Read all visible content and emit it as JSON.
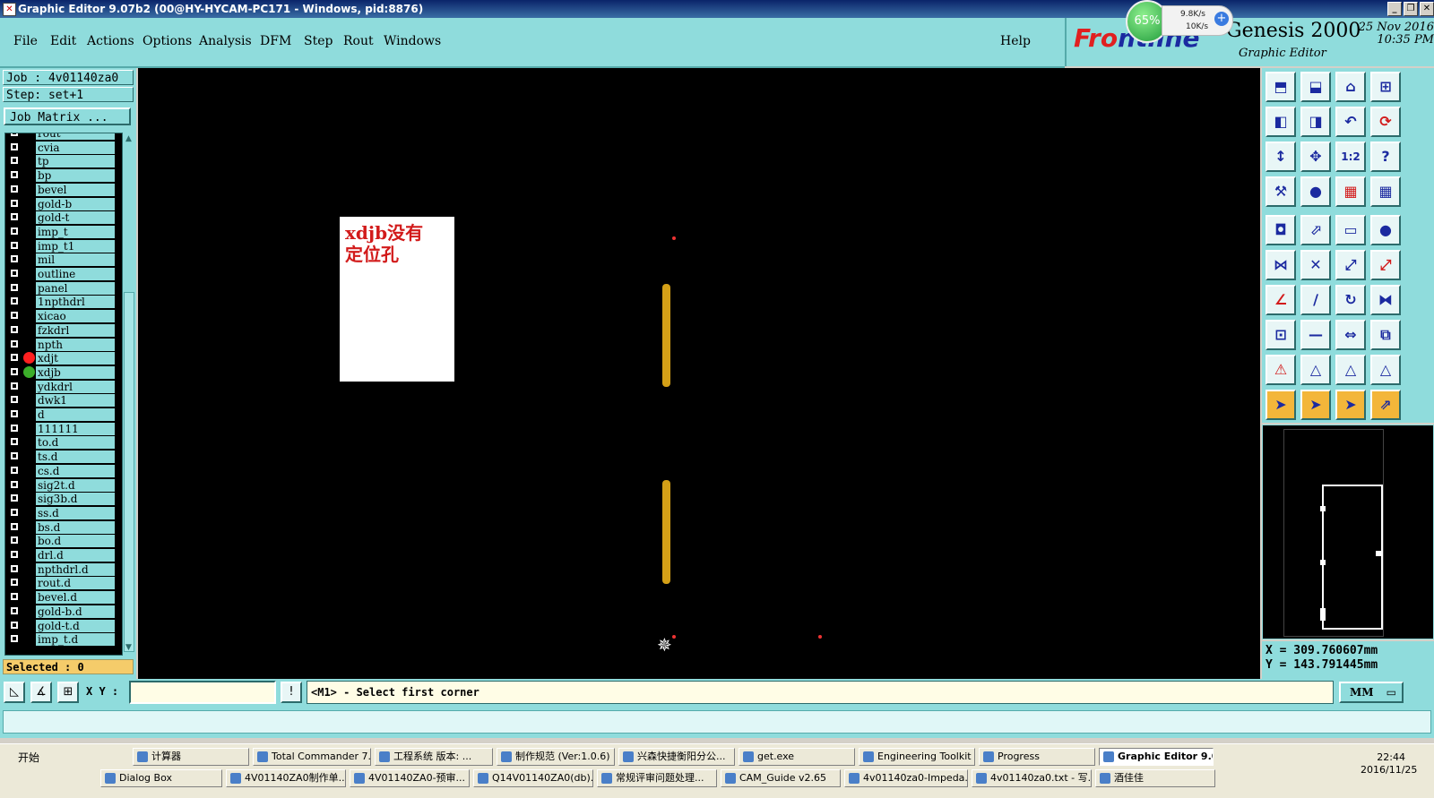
{
  "window": {
    "title": "Graphic Editor 9.07b2 (00@HY-HYCAM-PC171 - Windows, pid:8876)",
    "minimize": "_",
    "restore": "❐",
    "close": "✕"
  },
  "menu": {
    "items": [
      "File",
      "Edit",
      "Actions",
      "Options",
      "Analysis",
      "DFM",
      "Step",
      "Rout",
      "Windows"
    ],
    "help": "Help"
  },
  "brand": {
    "logo_main": "Fro",
    "logo_accent": "ntline",
    "product": "Genesis 2000",
    "subtitle": "Graphic Editor",
    "date": "25 Nov 2016",
    "time": "10:35 PM"
  },
  "network_widget": {
    "percent": "65%",
    "upload": "9.8K/s",
    "download": "10K/s"
  },
  "left_panel": {
    "job": "Job : 4v01140za0",
    "step": "Step: set+1",
    "job_matrix": "Job Matrix ...",
    "layers": [
      {
        "name": "rout",
        "dot": ""
      },
      {
        "name": "cvia",
        "dot": ""
      },
      {
        "name": "tp",
        "dot": ""
      },
      {
        "name": "bp",
        "dot": ""
      },
      {
        "name": "bevel",
        "dot": ""
      },
      {
        "name": "gold-b",
        "dot": ""
      },
      {
        "name": "gold-t",
        "dot": ""
      },
      {
        "name": "imp_t",
        "dot": ""
      },
      {
        "name": "imp_t1",
        "dot": ""
      },
      {
        "name": "mil",
        "dot": ""
      },
      {
        "name": "outline",
        "dot": ""
      },
      {
        "name": "panel",
        "dot": ""
      },
      {
        "name": "1npthdrl",
        "dot": ""
      },
      {
        "name": "xicao",
        "dot": ""
      },
      {
        "name": "fzkdrl",
        "dot": ""
      },
      {
        "name": "npth",
        "dot": ""
      },
      {
        "name": "xdjt",
        "dot": "#ff2020"
      },
      {
        "name": "xdjb",
        "dot": "#3cae2a"
      },
      {
        "name": "ydkdrl",
        "dot": ""
      },
      {
        "name": "dwk1",
        "dot": ""
      },
      {
        "name": "d",
        "dot": ""
      },
      {
        "name": "111111",
        "dot": ""
      },
      {
        "name": "to.d",
        "dot": ""
      },
      {
        "name": "ts.d",
        "dot": ""
      },
      {
        "name": "cs.d",
        "dot": ""
      },
      {
        "name": "sig2t.d",
        "dot": ""
      },
      {
        "name": "sig3b.d",
        "dot": ""
      },
      {
        "name": "ss.d",
        "dot": ""
      },
      {
        "name": "bs.d",
        "dot": ""
      },
      {
        "name": "bo.d",
        "dot": ""
      },
      {
        "name": "drl.d",
        "dot": ""
      },
      {
        "name": "npthdrl.d",
        "dot": ""
      },
      {
        "name": "rout.d",
        "dot": ""
      },
      {
        "name": "bevel.d",
        "dot": ""
      },
      {
        "name": "gold-b.d",
        "dot": ""
      },
      {
        "name": "gold-t.d",
        "dot": ""
      },
      {
        "name": "imp_t.d",
        "dot": ""
      }
    ],
    "selected": "Selected : 0"
  },
  "canvas": {
    "note_text": "xdjb没有\n定位孔",
    "pad_color": "#d4a017"
  },
  "toolbar": {
    "icons": [
      "zoom-home-icon",
      "zoom-out-icon",
      "home-icon",
      "split-view-icon",
      "pan-left-icon",
      "pan-right-icon",
      "undo-view-icon",
      "redraw-icon",
      "fit-height-icon",
      "fit-all-icon",
      "one-to-two-icon",
      "help-icon",
      "tools-icon",
      "snap-icon",
      "layer-red-icon",
      "layer-dual-icon",
      "pad-select-icon",
      "move-icon",
      "measure-icon",
      "round-pad-icon",
      "net-icon",
      "delete-icon",
      "connect-icon",
      "connect-red-icon",
      "line-red-icon",
      "line-icon",
      "rotate-icon",
      "mirror-icon",
      "pad-add-icon",
      "dash-icon",
      "dimension-icon",
      "group-icon",
      "triangle-red-icon",
      "triangle-icon",
      "triangle-blue-icon",
      "triangle-dual-icon",
      "cursor-icon",
      "cursor-select-icon",
      "cursor-box-icon",
      "route-icon"
    ],
    "glyphs": [
      "⬒",
      "⬓",
      "⌂",
      "⊞",
      "◧",
      "◨",
      "↶",
      "⟳",
      "↕",
      "✥",
      "1:2",
      "?",
      "⚒",
      "●",
      "▦",
      "▦",
      "◘",
      "⬀",
      "▭",
      "●",
      "⋈",
      "✕",
      "⤢",
      "⤢",
      "∠",
      "∕",
      "↻",
      "⧓",
      "⊡",
      "—",
      "⇔",
      "⧉",
      "⚠",
      "△",
      "△",
      "△",
      "➤",
      "➤",
      "➤",
      "⇗"
    ]
  },
  "coords": {
    "x": "X = 309.760607mm",
    "y": "Y = 143.791445mm"
  },
  "command_row": {
    "xy_label": "X Y :",
    "xy_value": "",
    "prompt": "<M1> - Select first corner",
    "units": "MM",
    "units_arrow": "▭"
  },
  "taskbar": {
    "start": "开始",
    "row1": [
      "计算器",
      "Total Commander 7...",
      "工程系统 版本: ...",
      "制作规范 (Ver:1.0.6)",
      "兴森快捷衡阳分公...",
      "get.exe",
      "Engineering Toolkit ...",
      "Progress",
      "Graphic Editor 9.0..."
    ],
    "row2": [
      "Dialog Box",
      "4V01140ZA0制作单...",
      "4V01140ZA0-预审...",
      "Q14V01140ZA0(db)...",
      "常规评审问题处理...",
      "CAM_Guide v2.65",
      "4v01140za0-Impeda...",
      "4v01140za0.txt - 写...",
      "酒佳佳"
    ],
    "time": "22:44",
    "date": "2016/11/25"
  }
}
